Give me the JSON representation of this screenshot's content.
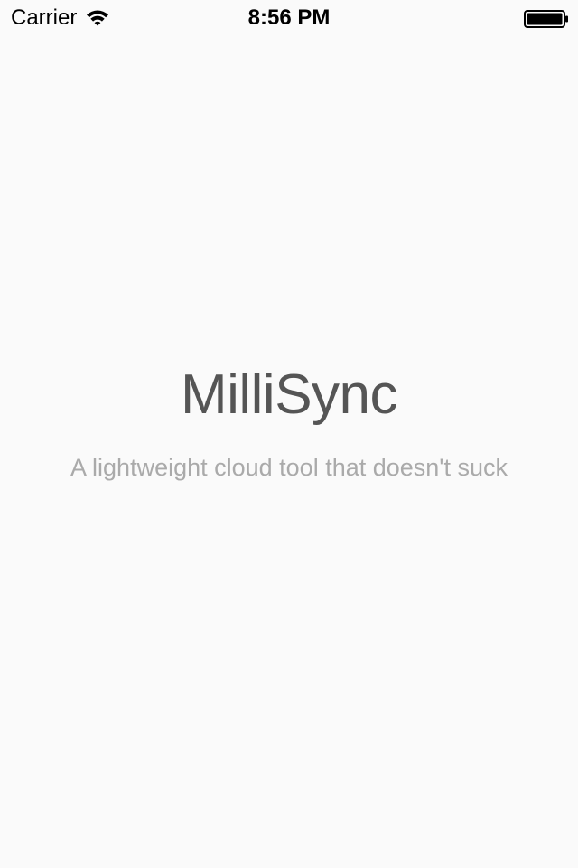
{
  "status_bar": {
    "carrier": "Carrier",
    "time": "8:56 PM",
    "wifi_icon": "wifi-icon",
    "battery_icon": "battery-icon"
  },
  "splash": {
    "title": "MilliSync",
    "tagline": "A lightweight cloud tool that doesn't suck"
  },
  "colors": {
    "background": "#fafafa",
    "title": "#555555",
    "tagline": "#aaaaaa",
    "status_text": "#000000"
  }
}
